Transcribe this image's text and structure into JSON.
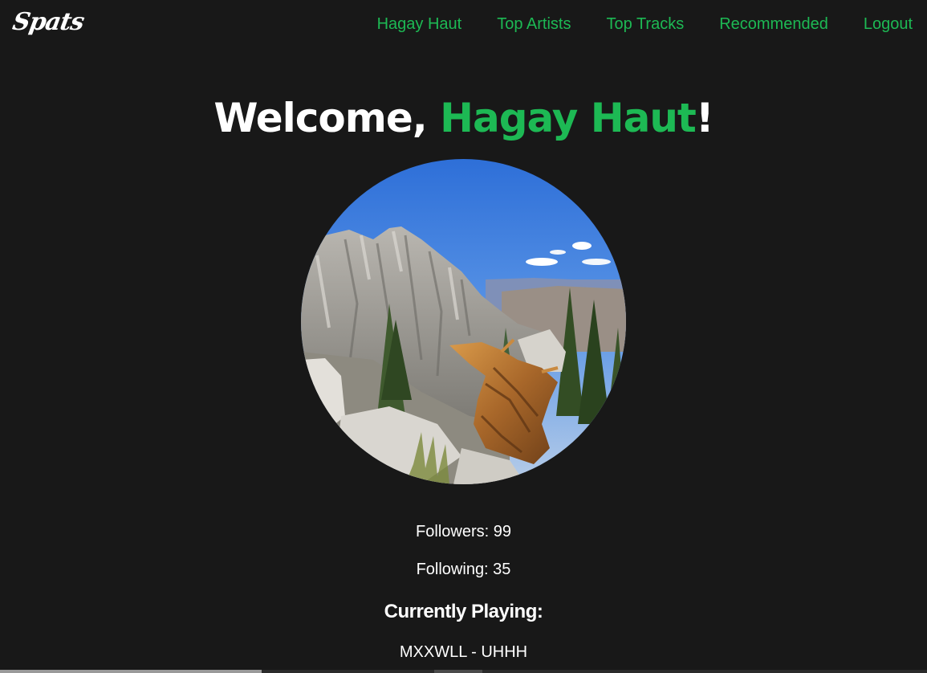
{
  "app": {
    "logo_text": "Spats"
  },
  "nav": {
    "items": [
      {
        "label": "Hagay Haut"
      },
      {
        "label": "Top Artists"
      },
      {
        "label": "Top Tracks"
      },
      {
        "label": "Recommended"
      },
      {
        "label": "Logout"
      }
    ]
  },
  "welcome": {
    "prefix": "Welcome, ",
    "name": "Hagay Haut",
    "suffix": "!"
  },
  "profile": {
    "followers": "Followers: 99",
    "following": "Following: 35"
  },
  "currently_playing": {
    "heading": "Currently Playing:",
    "track": "MXXWLL - UHHH"
  },
  "colors": {
    "background": "#181818",
    "accent": "#1db954",
    "text": "#ffffff"
  }
}
